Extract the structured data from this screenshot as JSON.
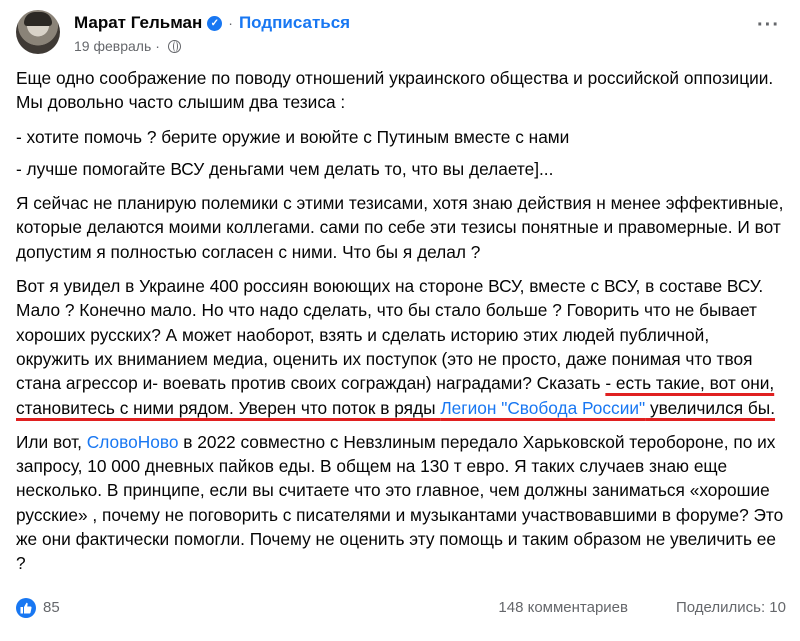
{
  "post": {
    "author": "Марат Гельман",
    "separator": "·",
    "subscribe_label": "Подписаться",
    "date": "19 февраль",
    "date_separator": "·",
    "more_label": "···"
  },
  "body": {
    "p1": "Еще одно соображение по поводу отношений украинского общества и российской оппозиции. Мы довольно часто слышим два тезиса :",
    "p2": "- хотите помочь ? берите оружие и воюйте с Путиным вместе с нами",
    "p3": "- лучше помогайте ВСУ деньгами чем делать то, что вы делаете]...",
    "p4": "Я сейчас не планирую полемики с этими тезисами, хотя знаю действия н менее эффективные,  которые делаются моими коллегами. сами по себе эти тезисы понятные и правомерные. И вот допустим я полностью согласен с ними. Что бы я делал ?",
    "p5_a": "Вот я увидел в Украине 400 россиян воюющих на стороне ВСУ, вместе с ВСУ, в составе ВСУ. Мало ? Конечно мало. Но что надо сделать, что бы стало больше ? Говорить что не бывает хороших русских? А может наоборот, взять и сделать историю этих людей публичной, окружить их вниманием медиа, оценить их поступок (это не просто, даже понимая что твоя стана агрессор и- воевать против своих сограждан) наградами? Сказать ",
    "p5_underlined": "- есть такие, вот они, становитесь с ними рядом. Уверен что поток в ряды ",
    "p5_link": "Легион \"Свобода России\"",
    "p5_end": "  увеличился бы.",
    "p6_a": "Или вот, ",
    "p6_link": "СловоНово",
    "p6_b": " в 2022 совместно с Невзлиным передало Харьковской тероборонe, по их запросу, 10 000 дневных пайков еды. В общем на 130 т евро.  Я таких случаев знаю еще несколько. В принципе, если вы считаете что это главное, чем должны заниматься «хорошие русские» , почему не поговорить с писателями и музыкантами участвовавшими в форуме? Это же они фактически помогли. Почему не оценить эту помощь и таким образом не увеличить ее ?"
  },
  "footer": {
    "likes": "85",
    "comments": "148 комментариев",
    "shares": "Поделились: 10"
  },
  "colors": {
    "link": "#1877f2",
    "annotation_underline": "#e02020",
    "muted": "#65676b"
  }
}
